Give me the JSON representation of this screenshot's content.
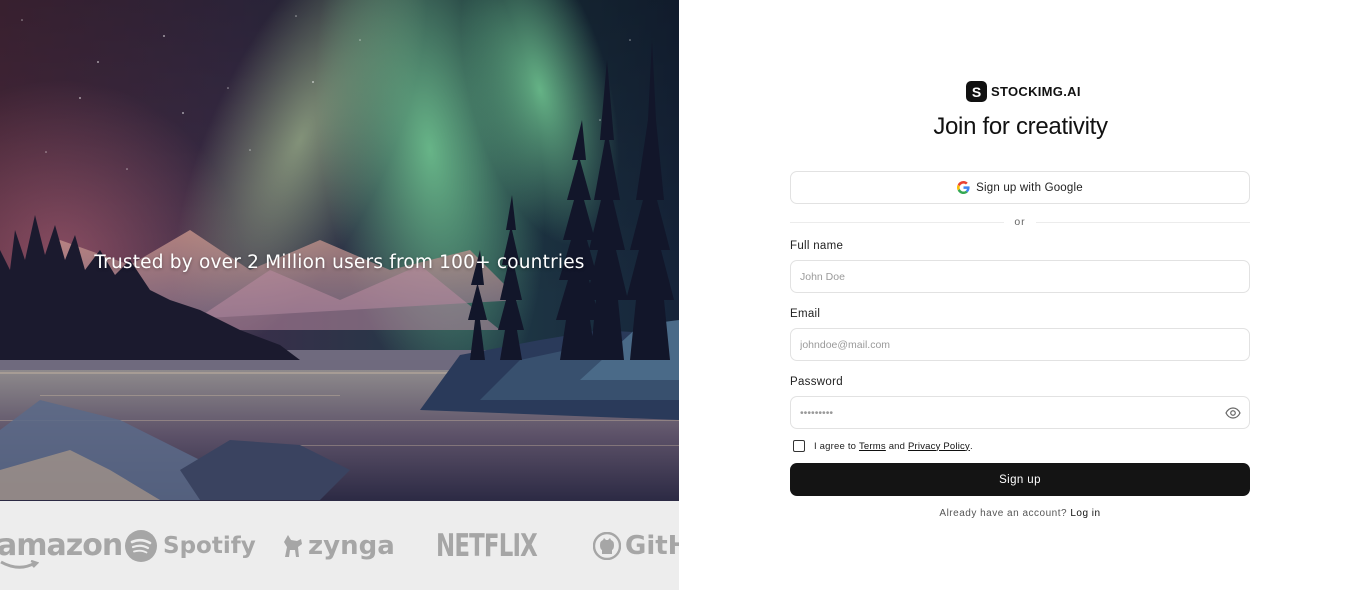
{
  "hero": {
    "tagline": "Trusted by over 2 Million users from 100+ countries"
  },
  "logos": {
    "items": [
      {
        "name": "amazon",
        "label": "amazon"
      },
      {
        "name": "spotify",
        "label": "Spotify"
      },
      {
        "name": "zynga",
        "label": "zynga"
      },
      {
        "name": "netflix",
        "label": "NETFLIX"
      },
      {
        "name": "github",
        "label": "GitHu"
      }
    ],
    "color": "#a6a6a6",
    "background": "#ededed"
  },
  "brand": {
    "mark": "S",
    "name": "STOCKIMG.AI"
  },
  "form": {
    "title": "Join for creativity",
    "google_label": "Sign up with Google",
    "divider_text": "or",
    "fullname_label": "Full name",
    "fullname_placeholder": "John Doe",
    "email_label": "Email",
    "email_placeholder": "johndoe@mail.com",
    "password_label": "Password",
    "password_mask": "•••••••••",
    "agree_prefix": "I agree to",
    "terms_link": "Terms",
    "agree_and": "and",
    "privacy_link": "Privacy Policy",
    "agree_suffix": ".",
    "submit_label": "Sign up",
    "login_prompt": "Already have an account?",
    "login_link": "Log in",
    "button_color": "#141414"
  }
}
